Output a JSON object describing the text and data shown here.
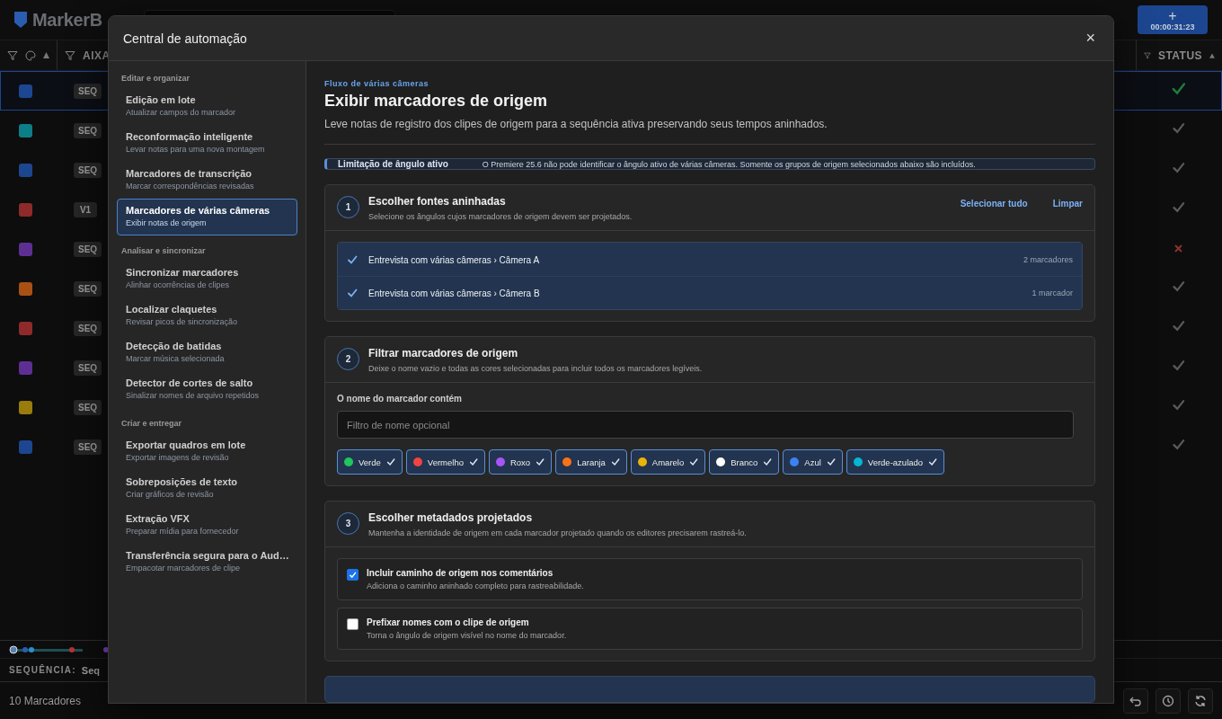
{
  "app": {
    "logo": "MarkerB",
    "timecode_button": {
      "label": "+",
      "time": "00:00:31:23"
    },
    "columns": [
      {
        "label": "AIXA"
      },
      {
        "label": "STATUS"
      }
    ],
    "rows": [
      {
        "color": "#1d4690",
        "badge": "SEQ",
        "done": true,
        "selected": true
      },
      {
        "color": "#0d7e88",
        "badge": "SEQ",
        "done": true,
        "selected": false
      },
      {
        "color": "#1d4690",
        "badge": "SEQ",
        "done": true,
        "selected": false
      },
      {
        "color": "#8e2a2a",
        "badge": "V1",
        "done": true,
        "selected": false
      },
      {
        "color": "#5e2f93",
        "badge": "SEQ",
        "done": false,
        "selected": false
      },
      {
        "color": "#a95114",
        "badge": "SEQ",
        "done": true,
        "selected": false
      },
      {
        "color": "#8e2a2a",
        "badge": "SEQ",
        "done": true,
        "selected": false
      },
      {
        "color": "#5e2f93",
        "badge": "SEQ",
        "done": true,
        "selected": false
      },
      {
        "color": "#9a7c0c",
        "badge": "SEQ",
        "done": true,
        "selected": false
      },
      {
        "color": "#1d4690",
        "badge": "SEQ",
        "done": true,
        "selected": false
      }
    ],
    "footer": {
      "sequence_label": "SEQUÊNCIA:",
      "sequence_value": "Seq",
      "count": "10 Marcadores"
    }
  },
  "modal": {
    "title": "Central de automação",
    "close": "×",
    "sidebar": [
      {
        "heading": "Editar e organizar",
        "items": [
          {
            "title": "Edição em lote",
            "subtitle": "Atualizar campos do marcador",
            "selected": false
          },
          {
            "title": "Reconformação inteligente",
            "subtitle": "Levar notas para uma nova montagem",
            "selected": false
          },
          {
            "title": "Marcadores de transcrição",
            "subtitle": "Marcar correspondências revisadas",
            "selected": false
          },
          {
            "title": "Marcadores de várias câmeras",
            "subtitle": "Exibir notas de origem",
            "selected": true
          }
        ]
      },
      {
        "heading": "Analisar e sincronizar",
        "items": [
          {
            "title": "Sincronizar marcadores",
            "subtitle": "Alinhar ocorrências de clipes",
            "selected": false
          },
          {
            "title": "Localizar claquetes",
            "subtitle": "Revisar picos de sincronização",
            "selected": false
          },
          {
            "title": "Detecção de batidas",
            "subtitle": "Marcar música selecionada",
            "selected": false
          },
          {
            "title": "Detector de cortes de salto",
            "subtitle": "Sinalizar nomes de arquivo repetidos",
            "selected": false
          }
        ]
      },
      {
        "heading": "Criar e entregar",
        "items": [
          {
            "title": "Exportar quadros em lote",
            "subtitle": "Exportar imagens de revisão",
            "selected": false
          },
          {
            "title": "Sobreposições de texto",
            "subtitle": "Criar gráficos de revisão",
            "selected": false
          },
          {
            "title": "Extração VFX",
            "subtitle": "Preparar mídia para fornecedor",
            "selected": false
          },
          {
            "title": "Transferência segura para o Aud…",
            "subtitle": "Empacotar marcadores de clipe",
            "selected": false
          }
        ]
      }
    ],
    "content": {
      "eyebrow": "Fluxo de várias câmeras",
      "title": "Exibir marcadores de origem",
      "description": "Leve notas de registro dos clipes de origem para a sequência ativa preservando seus tempos aninhados.",
      "notice": {
        "label": "Limitação de ângulo ativo",
        "text": "O Premiere 25.6 não pode identificar o ângulo ativo de várias câmeras. Somente os grupos de origem selecionados abaixo são incluídos."
      },
      "steps": [
        {
          "kind": "sources",
          "number": "1",
          "title": "Escolher fontes aninhadas",
          "description": "Selecione os ângulos cujos marcadores de origem devem ser projetados.",
          "actions": [
            "Selecionar tudo",
            "Limpar"
          ],
          "sources": [
            {
              "label": "Entrevista com várias câmeras › Câmera A",
              "count": "2 marcadores",
              "checked": true
            },
            {
              "label": "Entrevista com várias câmeras › Câmera B",
              "count": "1 marcador",
              "checked": true
            }
          ]
        },
        {
          "kind": "filter",
          "number": "2",
          "title": "Filtrar marcadores de origem",
          "description": "Deixe o nome vazio e todas as cores selecionadas para incluir todos os marcadores legíveis.",
          "field_label": "O nome do marcador contém",
          "placeholder": "Filtro de nome opcional",
          "colors": [
            {
              "name": "Verde",
              "color": "#22c55e",
              "selected": true
            },
            {
              "name": "Vermelho",
              "color": "#ef4444",
              "selected": true
            },
            {
              "name": "Roxo",
              "color": "#a855f7",
              "selected": true
            },
            {
              "name": "Laranja",
              "color": "#f97316",
              "selected": true
            },
            {
              "name": "Amarelo",
              "color": "#eab308",
              "selected": true
            },
            {
              "name": "Branco",
              "color": "#ffffff",
              "selected": true
            },
            {
              "name": "Azul",
              "color": "#3b82f6",
              "selected": true
            },
            {
              "name": "Verde-azulado",
              "color": "#06b6d4",
              "selected": true
            }
          ]
        },
        {
          "kind": "options",
          "number": "3",
          "title": "Escolher metadados projetados",
          "description": "Mantenha a identidade de origem em cada marcador projetado quando os editores precisarem rastreá-lo.",
          "options": [
            {
              "title": "Incluir caminho de origem nos comentários",
              "description": "Adiciona o caminho aninhado completo para rastreabilidade.",
              "checked": true
            },
            {
              "title": "Prefixar nomes com o clipe de origem",
              "description": "Torna o ângulo de origem visível no nome do marcador.",
              "checked": false
            }
          ]
        }
      ]
    }
  }
}
